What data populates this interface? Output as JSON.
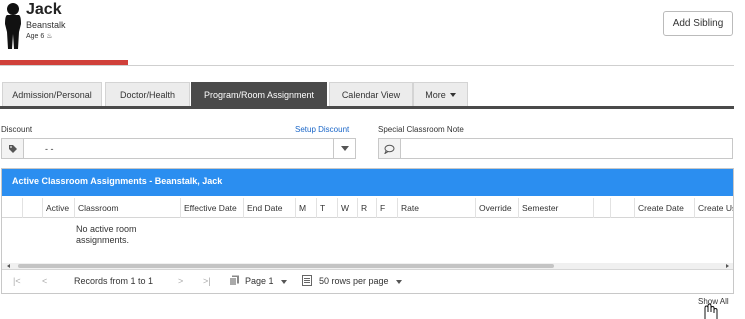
{
  "child": {
    "first_name": "Jack",
    "last_name": "Beanstalk",
    "age": "Age 6",
    "age_icon": "cake-icon"
  },
  "header": {
    "add_sibling_label": "Add Sibling"
  },
  "tabs": [
    {
      "label": "Admission/Personal",
      "active": false
    },
    {
      "label": "Doctor/Health",
      "active": false
    },
    {
      "label": "Program/Room Assignment",
      "active": true
    },
    {
      "label": "Calendar View",
      "active": false
    },
    {
      "label": "More",
      "active": false
    }
  ],
  "discount": {
    "label": "Discount",
    "setup_link": "Setup Discount",
    "value": "- -",
    "icon": "tag-icon"
  },
  "special_note": {
    "label": "Special Classroom Note",
    "value": "",
    "icon": "comment-icon"
  },
  "grid": {
    "title": "Active Classroom Assignments - Beanstalk, Jack",
    "columns": [
      "Active",
      "Classroom",
      "Effective Date",
      "End Date",
      "M",
      "T",
      "W",
      "R",
      "F",
      "Rate",
      "Override",
      "Semester",
      "Create Date",
      "Create Us"
    ],
    "empty_message": "No active room assignments.",
    "title_color": "#2b8ef0"
  },
  "pager": {
    "records": "Records from 1 to 1",
    "page": "Page 1",
    "rows_per_page": "50 rows per page"
  },
  "footer": {
    "show_all": "Show All"
  }
}
